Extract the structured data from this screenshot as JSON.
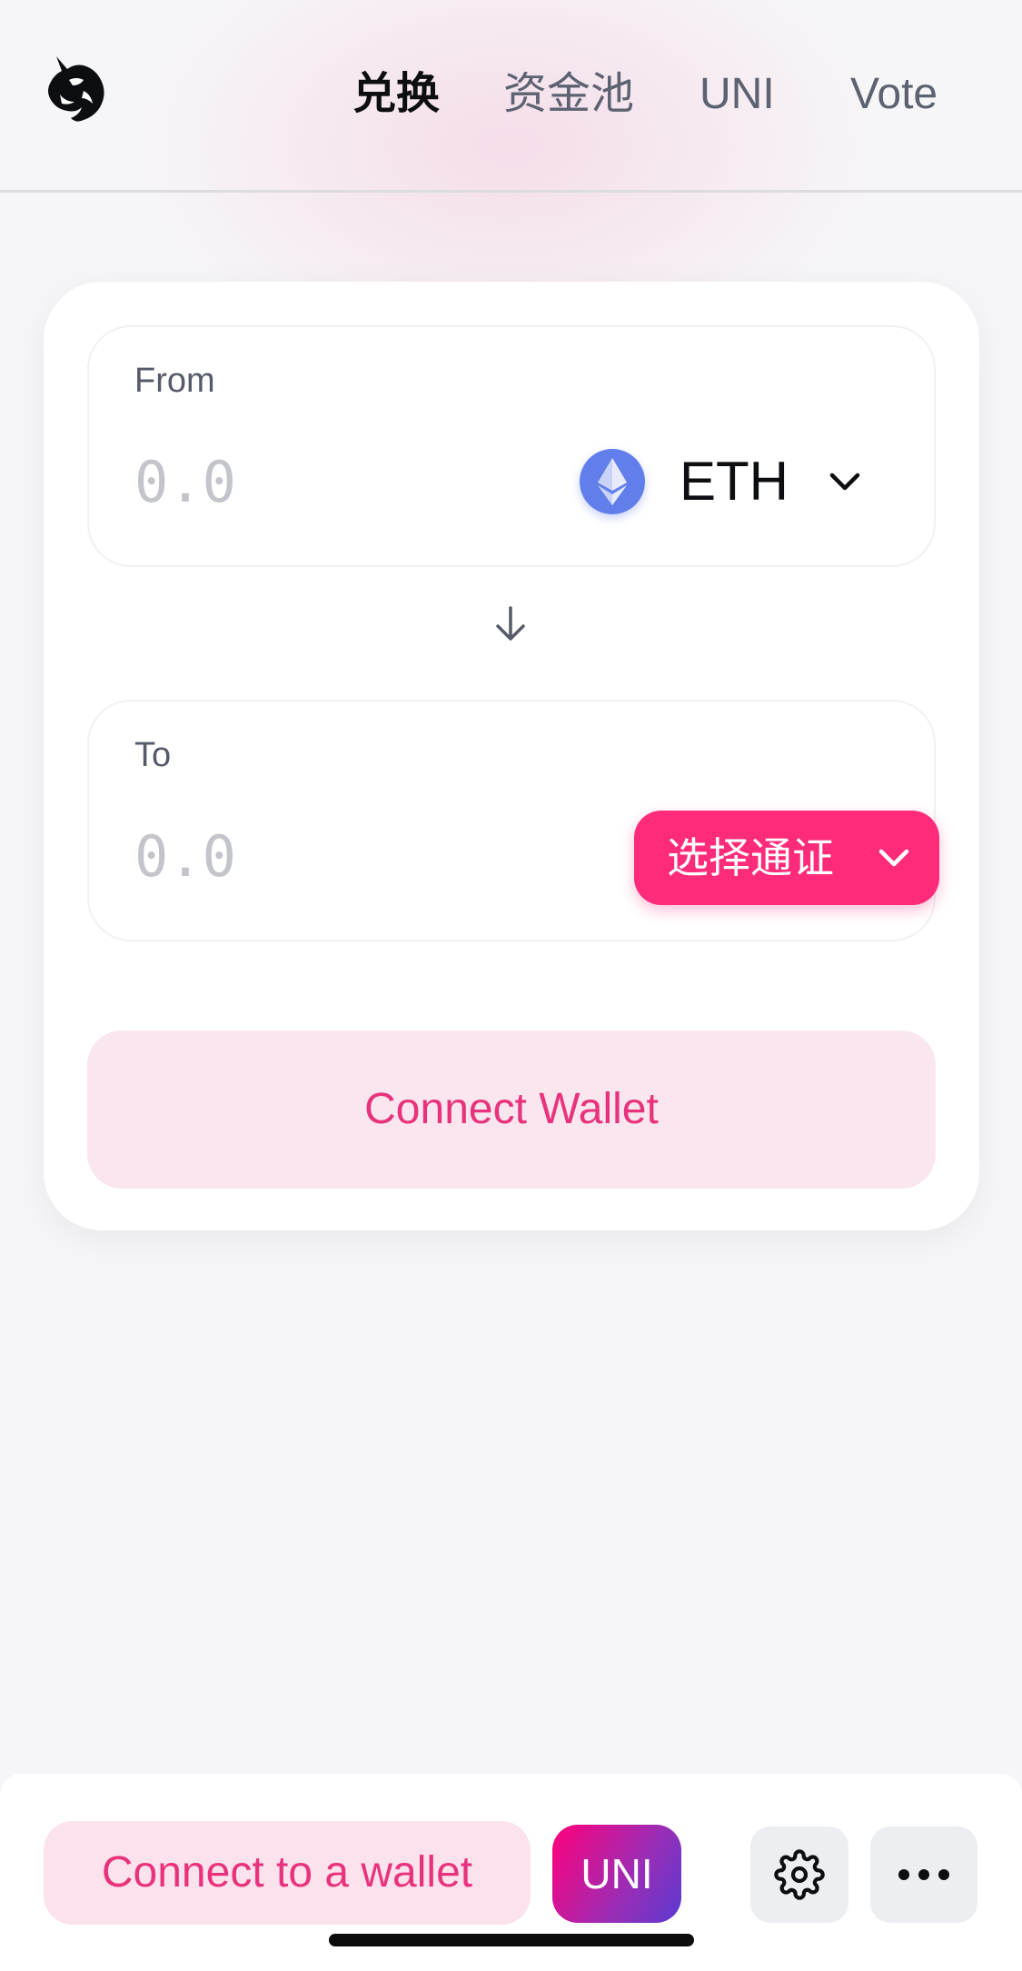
{
  "nav": {
    "logo": "uniswap-unicorn-logo",
    "items": [
      {
        "label": "兑换",
        "active": true
      },
      {
        "label": "资金池",
        "active": false
      },
      {
        "label": "UNI",
        "active": false
      },
      {
        "label": "Vote",
        "active": false
      }
    ]
  },
  "swap": {
    "from": {
      "label": "From",
      "placeholder": "0.0",
      "token_symbol": "ETH",
      "token_icon": "ethereum-icon"
    },
    "to": {
      "label": "To",
      "placeholder": "0.0",
      "select_label": "选择通证"
    },
    "connect_wallet_label": "Connect Wallet"
  },
  "bottom_bar": {
    "connect_label": "Connect to a wallet",
    "uni_label": "UNI",
    "settings_icon": "gear-icon",
    "more_icon": "more-horizontal-icon"
  },
  "colors": {
    "accent": "#fd2b7a",
    "accent_text": "#e8337c",
    "accent_soft": "#f9e6ef",
    "background": "#f6f6f8"
  }
}
